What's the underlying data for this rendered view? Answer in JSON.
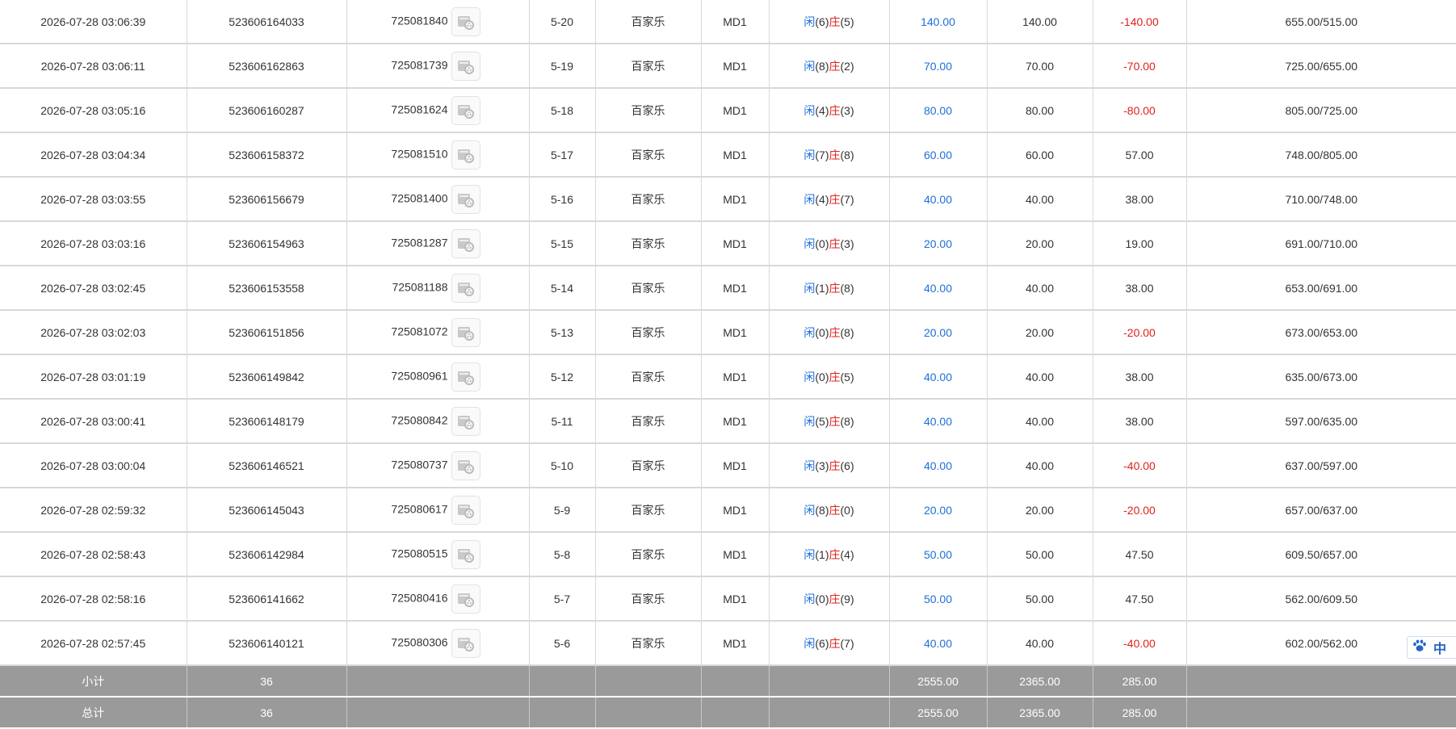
{
  "rows": [
    {
      "time": "2026-07-28 03:06:39",
      "bet_id": "523606164033",
      "round_id": "725081840",
      "shoe": "5-20",
      "game": "百家乐",
      "table": "MD1",
      "result": {
        "banker_label": "闲",
        "banker_score": "(6)",
        "player_label": "庄",
        "player_score": "(5)"
      },
      "bet_amount": "140.00",
      "valid_amount": "140.00",
      "win_loss": "-140.00",
      "win_loss_sign": "negative",
      "balance": "655.00/515.00"
    },
    {
      "time": "2026-07-28 03:06:11",
      "bet_id": "523606162863",
      "round_id": "725081739",
      "shoe": "5-19",
      "game": "百家乐",
      "table": "MD1",
      "result": {
        "banker_label": "闲",
        "banker_score": "(8)",
        "player_label": "庄",
        "player_score": "(2)"
      },
      "bet_amount": "70.00",
      "valid_amount": "70.00",
      "win_loss": "-70.00",
      "win_loss_sign": "negative",
      "balance": "725.00/655.00"
    },
    {
      "time": "2026-07-28 03:05:16",
      "bet_id": "523606160287",
      "round_id": "725081624",
      "shoe": "5-18",
      "game": "百家乐",
      "table": "MD1",
      "result": {
        "banker_label": "闲",
        "banker_score": "(4)",
        "player_label": "庄",
        "player_score": "(3)"
      },
      "bet_amount": "80.00",
      "valid_amount": "80.00",
      "win_loss": "-80.00",
      "win_loss_sign": "negative",
      "balance": "805.00/725.00"
    },
    {
      "time": "2026-07-28 03:04:34",
      "bet_id": "523606158372",
      "round_id": "725081510",
      "shoe": "5-17",
      "game": "百家乐",
      "table": "MD1",
      "result": {
        "banker_label": "闲",
        "banker_score": "(7)",
        "player_label": "庄",
        "player_score": "(8)"
      },
      "bet_amount": "60.00",
      "valid_amount": "60.00",
      "win_loss": "57.00",
      "win_loss_sign": "positive",
      "balance": "748.00/805.00"
    },
    {
      "time": "2026-07-28 03:03:55",
      "bet_id": "523606156679",
      "round_id": "725081400",
      "shoe": "5-16",
      "game": "百家乐",
      "table": "MD1",
      "result": {
        "banker_label": "闲",
        "banker_score": "(4)",
        "player_label": "庄",
        "player_score": "(7)"
      },
      "bet_amount": "40.00",
      "valid_amount": "40.00",
      "win_loss": "38.00",
      "win_loss_sign": "positive",
      "balance": "710.00/748.00"
    },
    {
      "time": "2026-07-28 03:03:16",
      "bet_id": "523606154963",
      "round_id": "725081287",
      "shoe": "5-15",
      "game": "百家乐",
      "table": "MD1",
      "result": {
        "banker_label": "闲",
        "banker_score": "(0)",
        "player_label": "庄",
        "player_score": "(3)"
      },
      "bet_amount": "20.00",
      "valid_amount": "20.00",
      "win_loss": "19.00",
      "win_loss_sign": "positive",
      "balance": "691.00/710.00"
    },
    {
      "time": "2026-07-28 03:02:45",
      "bet_id": "523606153558",
      "round_id": "725081188",
      "shoe": "5-14",
      "game": "百家乐",
      "table": "MD1",
      "result": {
        "banker_label": "闲",
        "banker_score": "(1)",
        "player_label": "庄",
        "player_score": "(8)"
      },
      "bet_amount": "40.00",
      "valid_amount": "40.00",
      "win_loss": "38.00",
      "win_loss_sign": "positive",
      "balance": "653.00/691.00"
    },
    {
      "time": "2026-07-28 03:02:03",
      "bet_id": "523606151856",
      "round_id": "725081072",
      "shoe": "5-13",
      "game": "百家乐",
      "table": "MD1",
      "result": {
        "banker_label": "闲",
        "banker_score": "(0)",
        "player_label": "庄",
        "player_score": "(8)"
      },
      "bet_amount": "20.00",
      "valid_amount": "20.00",
      "win_loss": "-20.00",
      "win_loss_sign": "negative",
      "balance": "673.00/653.00"
    },
    {
      "time": "2026-07-28 03:01:19",
      "bet_id": "523606149842",
      "round_id": "725080961",
      "shoe": "5-12",
      "game": "百家乐",
      "table": "MD1",
      "result": {
        "banker_label": "闲",
        "banker_score": "(0)",
        "player_label": "庄",
        "player_score": "(5)"
      },
      "bet_amount": "40.00",
      "valid_amount": "40.00",
      "win_loss": "38.00",
      "win_loss_sign": "positive",
      "balance": "635.00/673.00"
    },
    {
      "time": "2026-07-28 03:00:41",
      "bet_id": "523606148179",
      "round_id": "725080842",
      "shoe": "5-11",
      "game": "百家乐",
      "table": "MD1",
      "result": {
        "banker_label": "闲",
        "banker_score": "(5)",
        "player_label": "庄",
        "player_score": "(8)"
      },
      "bet_amount": "40.00",
      "valid_amount": "40.00",
      "win_loss": "38.00",
      "win_loss_sign": "positive",
      "balance": "597.00/635.00"
    },
    {
      "time": "2026-07-28 03:00:04",
      "bet_id": "523606146521",
      "round_id": "725080737",
      "shoe": "5-10",
      "game": "百家乐",
      "table": "MD1",
      "result": {
        "banker_label": "闲",
        "banker_score": "(3)",
        "player_label": "庄",
        "player_score": "(6)"
      },
      "bet_amount": "40.00",
      "valid_amount": "40.00",
      "win_loss": "-40.00",
      "win_loss_sign": "negative",
      "balance": "637.00/597.00"
    },
    {
      "time": "2026-07-28 02:59:32",
      "bet_id": "523606145043",
      "round_id": "725080617",
      "shoe": "5-9",
      "game": "百家乐",
      "table": "MD1",
      "result": {
        "banker_label": "闲",
        "banker_score": "(8)",
        "player_label": "庄",
        "player_score": "(0)"
      },
      "bet_amount": "20.00",
      "valid_amount": "20.00",
      "win_loss": "-20.00",
      "win_loss_sign": "negative",
      "balance": "657.00/637.00"
    },
    {
      "time": "2026-07-28 02:58:43",
      "bet_id": "523606142984",
      "round_id": "725080515",
      "shoe": "5-8",
      "game": "百家乐",
      "table": "MD1",
      "result": {
        "banker_label": "闲",
        "banker_score": "(1)",
        "player_label": "庄",
        "player_score": "(4)"
      },
      "bet_amount": "50.00",
      "valid_amount": "50.00",
      "win_loss": "47.50",
      "win_loss_sign": "positive",
      "balance": "609.50/657.00"
    },
    {
      "time": "2026-07-28 02:58:16",
      "bet_id": "523606141662",
      "round_id": "725080416",
      "shoe": "5-7",
      "game": "百家乐",
      "table": "MD1",
      "result": {
        "banker_label": "闲",
        "banker_score": "(0)",
        "player_label": "庄",
        "player_score": "(9)"
      },
      "bet_amount": "50.00",
      "valid_amount": "50.00",
      "win_loss": "47.50",
      "win_loss_sign": "positive",
      "balance": "562.00/609.50"
    },
    {
      "time": "2026-07-28 02:57:45",
      "bet_id": "523606140121",
      "round_id": "725080306",
      "shoe": "5-6",
      "game": "百家乐",
      "table": "MD1",
      "result": {
        "banker_label": "闲",
        "banker_score": "(6)",
        "player_label": "庄",
        "player_score": "(7)"
      },
      "bet_amount": "40.00",
      "valid_amount": "40.00",
      "win_loss": "-40.00",
      "win_loss_sign": "negative",
      "balance": "602.00/562.00"
    }
  ],
  "subtotal": {
    "label": "小计",
    "count": "36",
    "bet_amount": "2555.00",
    "valid_amount": "2365.00",
    "win_loss": "285.00"
  },
  "total": {
    "label": "总计",
    "count": "36",
    "bet_amount": "2555.00",
    "valid_amount": "2365.00",
    "win_loss": "285.00"
  },
  "ime": {
    "icon": "paw-icon",
    "label": "中"
  },
  "colors": {
    "blue": "#1e6fd9",
    "red": "#e0201b",
    "summary_bg": "#9a9a9a",
    "grid": "#d8d8d8"
  },
  "icons": {
    "replay": "video-replay-icon"
  }
}
